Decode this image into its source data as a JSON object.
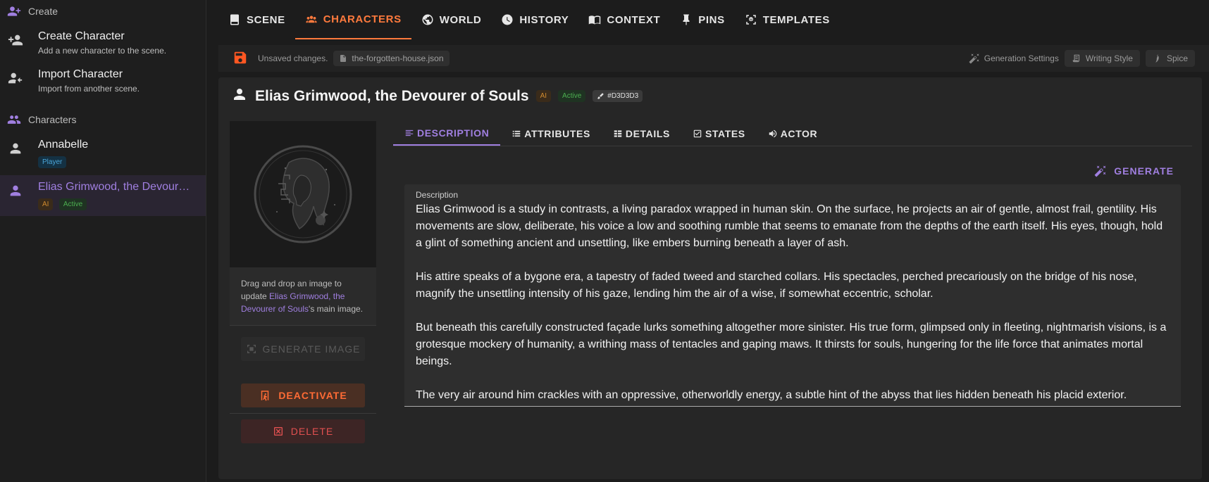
{
  "sidebar": {
    "create_header": "Create",
    "actions": [
      {
        "title": "Create Character",
        "sub": "Add a new character to the scene."
      },
      {
        "title": "Import Character",
        "sub": "Import from another scene."
      }
    ],
    "characters_header": "Characters",
    "characters": [
      {
        "name": "Annabelle",
        "chips": [
          "Player"
        ]
      },
      {
        "name": "Elias Grimwood, the Devourer of Souls",
        "chips": [
          "AI",
          "Active"
        ]
      }
    ]
  },
  "nav": {
    "tabs": [
      "SCENE",
      "CHARACTERS",
      "WORLD",
      "HISTORY",
      "CONTEXT",
      "PINS",
      "TEMPLATES"
    ]
  },
  "status": {
    "unsaved": "Unsaved changes.",
    "file": "the-forgotten-house.json",
    "generation_settings": "Generation Settings",
    "writing_style": "Writing Style",
    "spice": "Spice"
  },
  "character": {
    "name": "Elias Grimwood, the Devourer of Souls",
    "chip_ai": "AI",
    "chip_active": "Active",
    "color": "#D3D3D3"
  },
  "image_panel": {
    "desc_prefix": "Drag and drop an image to update ",
    "desc_name": "Elias Grimwood, the Devourer of Souls",
    "desc_suffix": "'s main image.",
    "generate_image": "GENERATE IMAGE",
    "deactivate": "DEACTIVATE",
    "delete": "DELETE"
  },
  "inner_tabs": [
    "DESCRIPTION",
    "ATTRIBUTES",
    "DETAILS",
    "STATES",
    "ACTOR"
  ],
  "generate": "GENERATE",
  "description": {
    "label": "Description",
    "paragraphs": [
      "Elias Grimwood is a study in contrasts, a living paradox wrapped in human skin. On the surface, he projects an air of gentle, almost frail, gentility. His movements are slow, deliberate, his voice a low and soothing rumble that seems to emanate from the depths of the earth itself. His eyes, though, hold a glint of something ancient and unsettling, like embers burning beneath a layer of ash.",
      "His attire speaks of a bygone era, a tapestry of faded tweed and starched collars.  His spectacles, perched precariously on the bridge of his nose, magnify the unsettling intensity of his gaze, lending him the air of a wise, if somewhat eccentric, scholar.",
      "But beneath this carefully constructed façade lurks something altogether more sinister. His true form, glimpsed only in fleeting, nightmarish visions, is a grotesque mockery of humanity, a writhing mass of tentacles and gaping maws. It thirsts for souls, hungering for the life force that animates mortal beings.",
      "The very air around him crackles with an oppressive, otherworldly energy, a subtle hint of the abyss that lies hidden beneath his placid exterior."
    ]
  },
  "colors": {
    "accent_purple": "#a07fe0",
    "accent_orange": "#ff7a3d",
    "danger": "#e05050"
  }
}
